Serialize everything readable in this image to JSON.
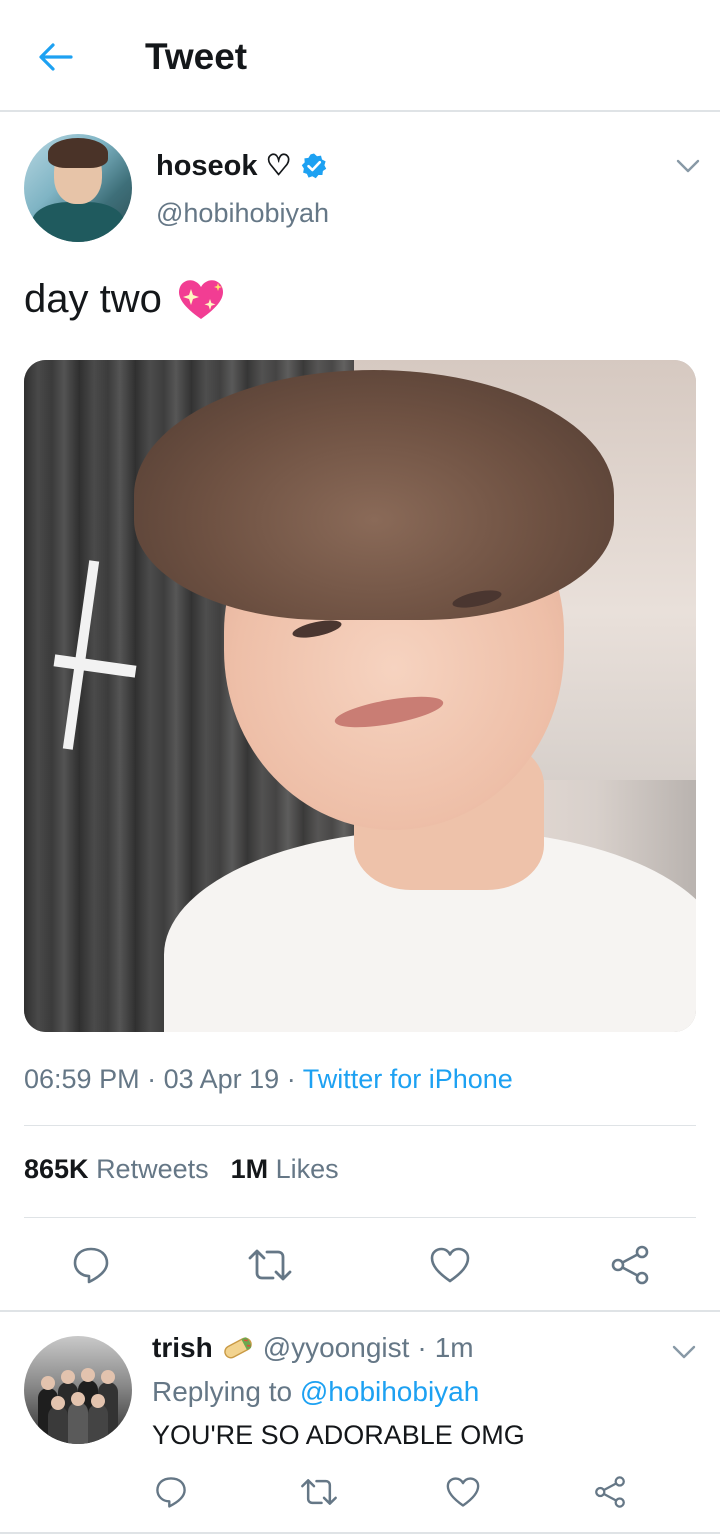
{
  "header": {
    "title": "Tweet",
    "back_icon": "arrow-left-icon",
    "accent": "#1da1f2"
  },
  "tweet": {
    "display_name": "hoseok ♡",
    "verified": true,
    "handle": "@hobihobiyah",
    "text": "day two",
    "emoji": "sparkling-heart-icon",
    "time": "06:59 PM",
    "date": "03 Apr 19",
    "separator": "·",
    "source": "Twitter for iPhone",
    "retweets_count": "865K",
    "retweets_label": "Retweets",
    "likes_count": "1M",
    "likes_label": "Likes",
    "actions": [
      "reply-icon",
      "retweet-icon",
      "like-icon",
      "share-icon"
    ]
  },
  "reply": {
    "display_name": "trish",
    "emoji": "burrito-icon",
    "handle": "@yyoongist",
    "separator": "·",
    "time": "1m",
    "replying_label": "Replying to",
    "replying_handle": "@hobihobiyah",
    "text": "YOU'RE SO ADORABLE OMG",
    "actions": [
      "reply-icon",
      "retweet-icon",
      "like-icon",
      "share-icon"
    ]
  },
  "colors": {
    "text": "#14171a",
    "secondary": "#657786",
    "link": "#1da1f2",
    "divider": "#dfe3e6"
  }
}
